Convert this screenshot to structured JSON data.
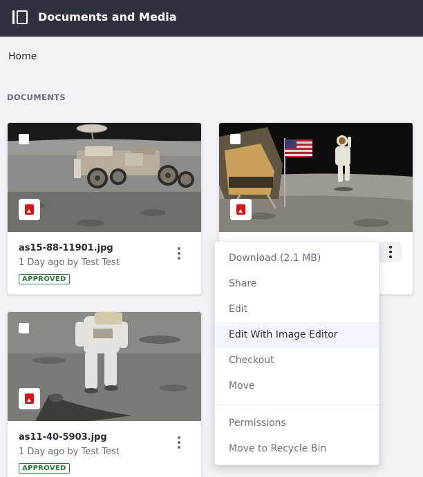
{
  "app": {
    "title": "Documents and Media"
  },
  "breadcrumb": "Home",
  "section_label": "DOCUMENTS",
  "cards": [
    {
      "file_name": "as15-88-11901.jpg",
      "meta": "1 Day ago by Test Test",
      "status": "APPROVED",
      "thumbnail": "lunar-rover-photo",
      "type_icon": "image-file-icon"
    },
    {
      "file_name": "",
      "meta": "",
      "status": "",
      "thumbnail": "astronaut-flag-salute-photo",
      "type_icon": "image-file-icon"
    },
    {
      "file_name": "as11-40-5903.jpg",
      "meta": "1 Day ago by Test Test",
      "status": "APPROVED",
      "thumbnail": "astronaut-moonwalk-photo",
      "type_icon": "image-file-icon"
    }
  ],
  "actions_menu": {
    "items": [
      {
        "label": "Download (2.1 MB)"
      },
      {
        "label": "Share"
      },
      {
        "label": "Edit"
      },
      {
        "label": "Edit With Image Editor"
      },
      {
        "label": "Checkout"
      },
      {
        "label": "Move"
      },
      {
        "label": "Permissions"
      },
      {
        "label": "Move to Recycle Bin"
      }
    ],
    "highlighted_item": "Edit With Image Editor"
  },
  "colors": {
    "topbar": "#30313f",
    "approved": "#287d3c",
    "file_icon": "#da1414",
    "menu_highlight": "#f0f5ff"
  }
}
